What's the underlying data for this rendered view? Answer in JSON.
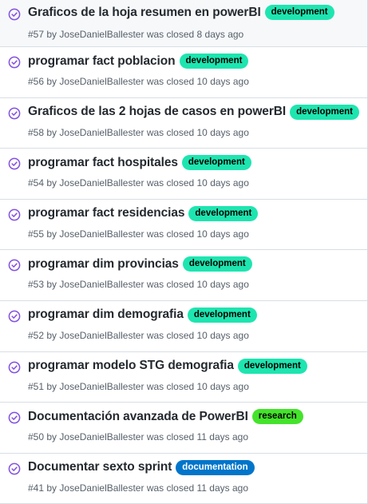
{
  "issues": [
    {
      "title": "Graficos de la hoja resumen en powerBI",
      "number": "#57",
      "by": "by",
      "author": "JoseDanielBallester",
      "status": "was closed 8 days ago",
      "label": {
        "text": "development",
        "color": "#1ee5b0",
        "text_color": "#000000"
      }
    },
    {
      "title": "programar fact poblacion",
      "number": "#56",
      "by": "by",
      "author": "JoseDanielBallester",
      "status": "was closed 10 days ago",
      "label": {
        "text": "development",
        "color": "#1ee5b0",
        "text_color": "#000000"
      }
    },
    {
      "title": "Graficos de las 2 hojas de casos en powerBI",
      "number": "#58",
      "by": "by",
      "author": "JoseDanielBallester",
      "status": "was closed 10 days ago",
      "label": {
        "text": "development",
        "color": "#1ee5b0",
        "text_color": "#000000"
      }
    },
    {
      "title": "programar fact hospitales",
      "number": "#54",
      "by": "by",
      "author": "JoseDanielBallester",
      "status": "was closed 10 days ago",
      "label": {
        "text": "development",
        "color": "#1ee5b0",
        "text_color": "#000000"
      }
    },
    {
      "title": "programar fact residencias",
      "number": "#55",
      "by": "by",
      "author": "JoseDanielBallester",
      "status": "was closed 10 days ago",
      "label": {
        "text": "development",
        "color": "#1ee5b0",
        "text_color": "#000000"
      }
    },
    {
      "title": "programar dim provincias",
      "number": "#53",
      "by": "by",
      "author": "JoseDanielBallester",
      "status": "was closed 10 days ago",
      "label": {
        "text": "development",
        "color": "#1ee5b0",
        "text_color": "#000000"
      }
    },
    {
      "title": "programar dim demografia",
      "number": "#52",
      "by": "by",
      "author": "JoseDanielBallester",
      "status": "was closed 10 days ago",
      "label": {
        "text": "development",
        "color": "#1ee5b0",
        "text_color": "#000000"
      }
    },
    {
      "title": "programar modelo STG demografia",
      "number": "#51",
      "by": "by",
      "author": "JoseDanielBallester",
      "status": "was closed 10 days ago",
      "label": {
        "text": "development",
        "color": "#1ee5b0",
        "text_color": "#000000"
      }
    },
    {
      "title": "Documentación avanzada de PowerBI",
      "number": "#50",
      "by": "by",
      "author": "JoseDanielBallester",
      "status": "was closed 11 days ago",
      "label": {
        "text": "research",
        "color": "#45e32c",
        "text_color": "#000000"
      }
    },
    {
      "title": "Documentar sexto sprint",
      "number": "#41",
      "by": "by",
      "author": "JoseDanielBallester",
      "status": "was closed 11 days ago",
      "label": {
        "text": "documentation",
        "color": "#0075ca",
        "text_color": "#ffffff"
      }
    }
  ],
  "icon": {
    "name": "issue-closed-icon",
    "color": "#8250df"
  }
}
